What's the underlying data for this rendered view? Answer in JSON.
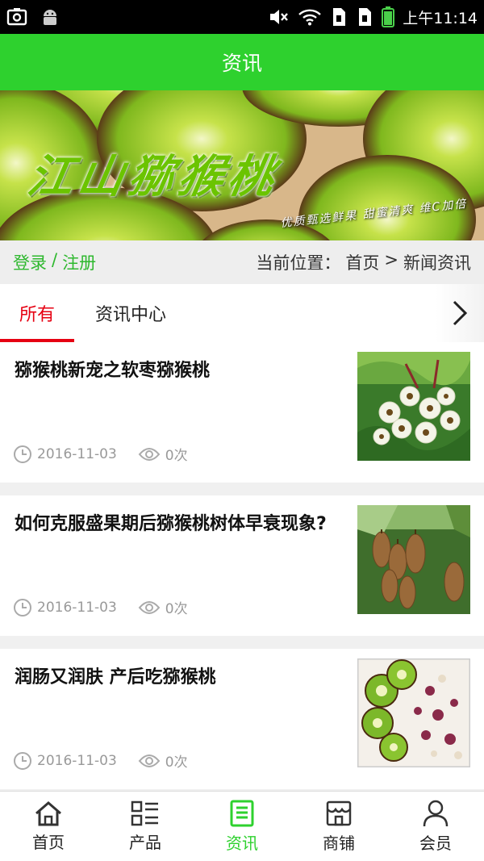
{
  "status_bar": {
    "time": "上午11:14"
  },
  "header": {
    "title": "资讯"
  },
  "banner": {
    "title": "江山猕猴桃",
    "tagline": "优质甄选鲜果 甜蜜清爽 维C加倍"
  },
  "location": {
    "login": "登录",
    "separator": "/",
    "register": "注册",
    "label": "当前位置：",
    "home": "首页",
    "arrow": ">",
    "current": "新闻资讯"
  },
  "tabs": [
    {
      "label": "所有",
      "active": true
    },
    {
      "label": "资讯中心",
      "active": false
    }
  ],
  "news": [
    {
      "title": "猕猴桃新宠之软枣猕猴桃",
      "date": "2016-11-03",
      "views": "0次",
      "thumb": "kiwi-flowers"
    },
    {
      "title": "如何克服盛果期后猕猴桃树体早衰现象?",
      "date": "2016-11-03",
      "views": "0次",
      "thumb": "kiwi-on-tree"
    },
    {
      "title": "润肠又润肤 产后吃猕猴桃",
      "date": "2016-11-03",
      "views": "0次",
      "thumb": "kiwi-yogurt"
    }
  ],
  "tabbar": [
    {
      "label": "首页",
      "icon": "home-icon",
      "active": false
    },
    {
      "label": "产品",
      "icon": "grid-list-icon",
      "active": false
    },
    {
      "label": "资讯",
      "icon": "document-icon",
      "active": true
    },
    {
      "label": "商铺",
      "icon": "store-icon",
      "active": false
    },
    {
      "label": "会员",
      "icon": "user-icon",
      "active": false
    }
  ],
  "colors": {
    "brand_green": "#2ed12e",
    "active_tab_red": "#e60012",
    "link_green": "#2eb82e"
  }
}
